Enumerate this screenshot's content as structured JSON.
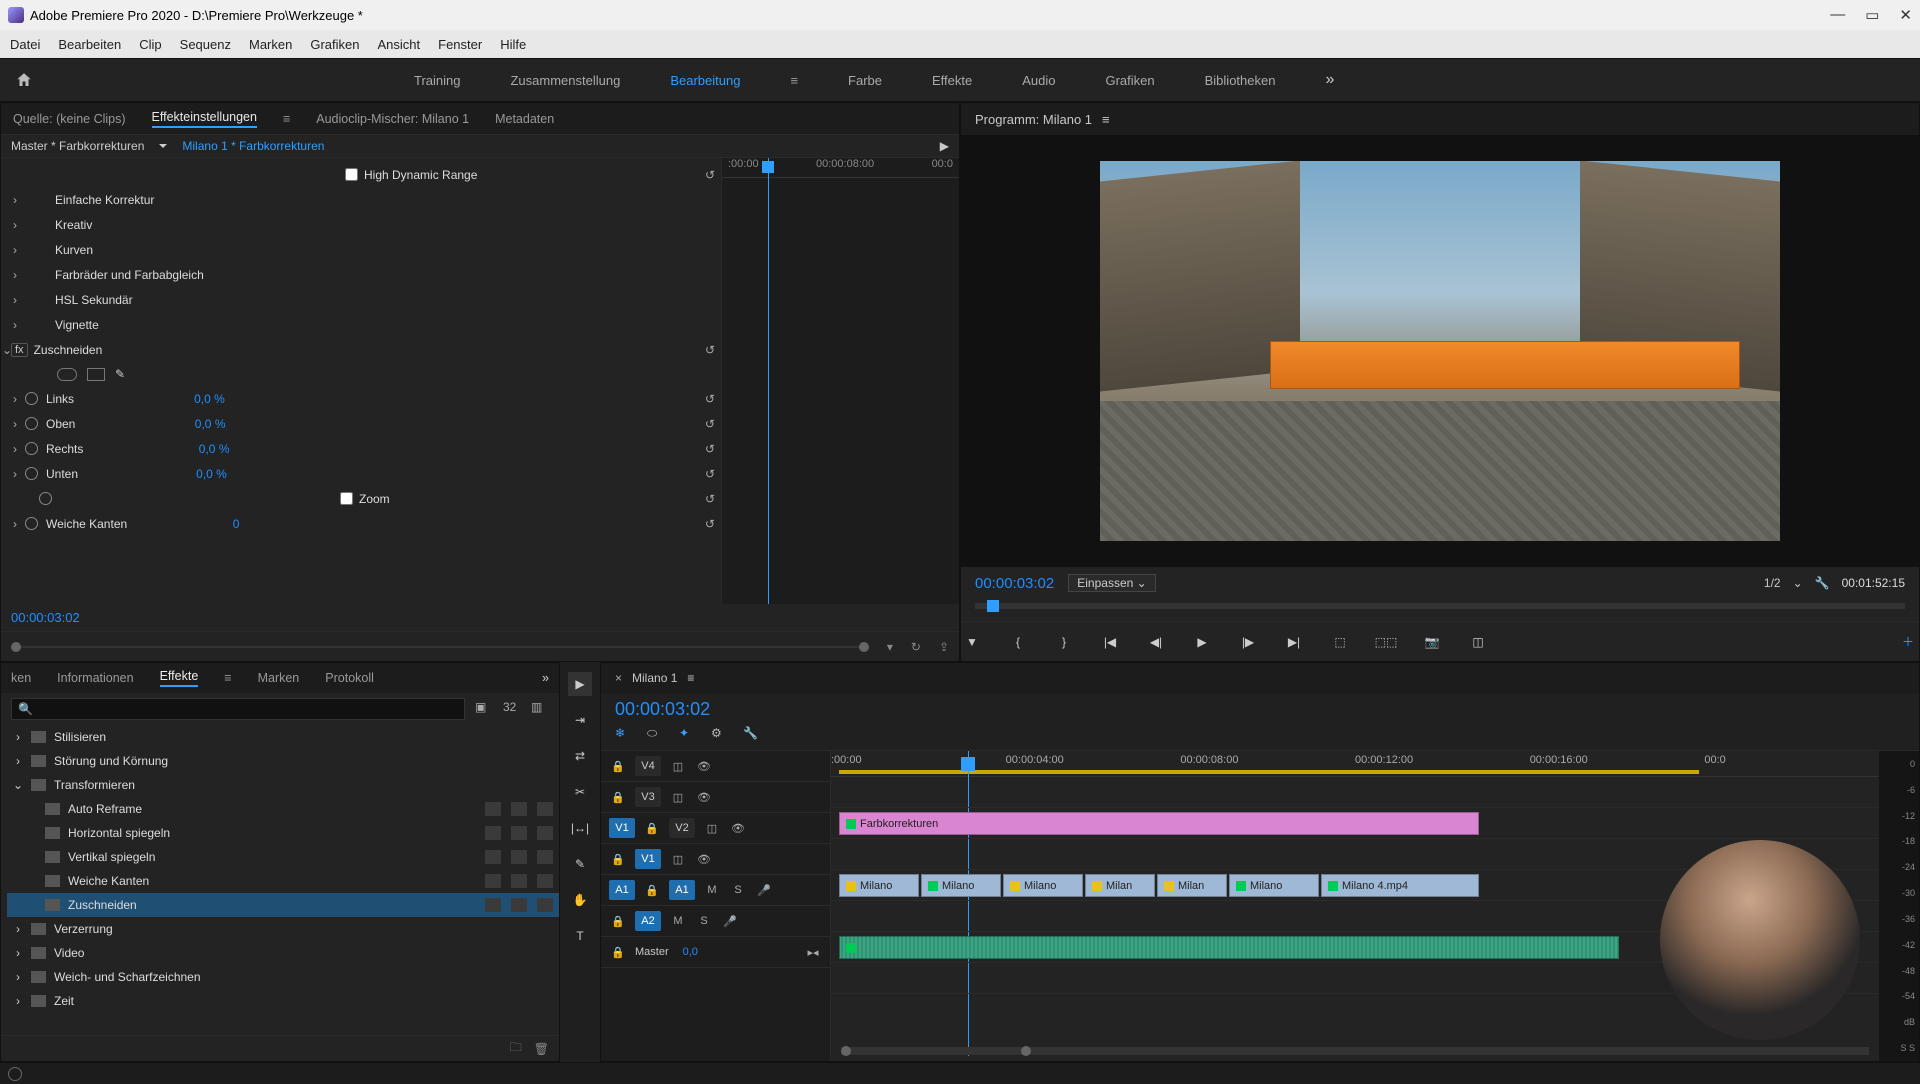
{
  "titlebar": {
    "title": "Adobe Premiere Pro 2020 - D:\\Premiere Pro\\Werkzeuge *"
  },
  "menubar": [
    "Datei",
    "Bearbeiten",
    "Clip",
    "Sequenz",
    "Marken",
    "Grafiken",
    "Ansicht",
    "Fenster",
    "Hilfe"
  ],
  "workspaces": {
    "items": [
      "Training",
      "Zusammenstellung",
      "Bearbeitung",
      "Farbe",
      "Effekte",
      "Audio",
      "Grafiken",
      "Bibliotheken"
    ],
    "active": "Bearbeitung"
  },
  "source_tabs": {
    "source": "Quelle: (keine Clips)",
    "effect_controls": "Effekteinstellungen",
    "audio_mixer": "Audioclip-Mischer: Milano 1",
    "metadata": "Metadaten"
  },
  "clip_header": {
    "master": "Master * Farbkorrekturen",
    "clip": "Milano 1 * Farbkorrekturen",
    "timeA": ":00:00",
    "timeB": "00:00:08:00",
    "timeC": "00:0"
  },
  "effect_controls": {
    "hdr_checkbox": "High Dynamic Range",
    "groups": [
      "Einfache Korrektur",
      "Kreativ",
      "Kurven",
      "Farbräder und Farbabgleich",
      "HSL Sekundär",
      "Vignette"
    ],
    "crop": {
      "name": "Zuschneiden",
      "links": {
        "label": "Links",
        "value": "0,0 %"
      },
      "oben": {
        "label": "Oben",
        "value": "0,0 %"
      },
      "rechts": {
        "label": "Rechts",
        "value": "0,0 %"
      },
      "unten": {
        "label": "Unten",
        "value": "0,0 %"
      },
      "zoom": {
        "label": "Zoom"
      },
      "weiche": {
        "label": "Weiche Kanten",
        "value": "0"
      }
    },
    "timecode": "00:00:03:02"
  },
  "program": {
    "title": "Programm: Milano 1",
    "timecode": "00:00:03:02",
    "fit": "Einpassen",
    "scale": "1/2",
    "duration": "00:01:52:15"
  },
  "project_tabs": [
    "ken",
    "Informationen",
    "Effekte",
    "Marken",
    "Protokoll"
  ],
  "project_tabs_active": "Effekte",
  "fx_tree": {
    "stilisieren": "Stilisieren",
    "noise": "Störung und Körnung",
    "transform": "Transformieren",
    "transform_children": [
      "Auto Reframe",
      "Horizontal spiegeln",
      "Vertikal spiegeln",
      "Weiche Kanten",
      "Zuschneiden"
    ],
    "verzerrung": "Verzerrung",
    "video": "Video",
    "sharpen": "Weich- und Scharfzeichnen",
    "zeit": "Zeit"
  },
  "timeline": {
    "seq_name": "Milano 1",
    "timecode": "00:00:03:02",
    "ruler": [
      ":00:00",
      "00:00:04:00",
      "00:00:08:00",
      "00:00:12:00",
      "00:00:16:00",
      "00:0"
    ],
    "tracks": {
      "v4": "V4",
      "v3": "V3",
      "v2": "V2",
      "v1": "V1",
      "a1": "A1",
      "a2": "A2",
      "master": "Master",
      "master_val": "0,0",
      "v1_src": "V1",
      "a1_src": "A1",
      "mute": "M",
      "solo": "S"
    },
    "adj_clip": "Farbkorrekturen",
    "video_clips": [
      "Milano",
      "Milano",
      "Milano",
      "Milan",
      "Milan",
      "Milano",
      "Milano 4.mp4"
    ]
  },
  "audio_meter_scale": [
    "0",
    "-6",
    "-12",
    "-18",
    "-24",
    "-30",
    "-36",
    "-42",
    "-48",
    "-54",
    "dB"
  ],
  "audio_meter_foot": "S   S"
}
